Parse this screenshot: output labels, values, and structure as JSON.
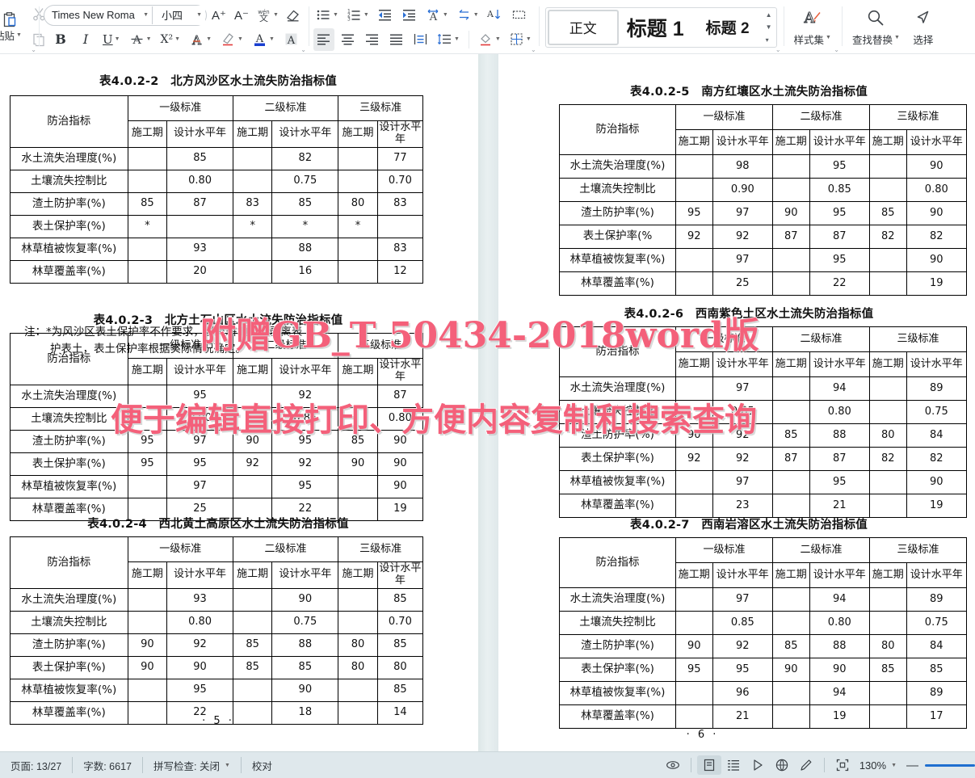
{
  "ribbon": {
    "paste": {
      "label": "粘贴",
      "icon": "paste-icon"
    },
    "cut": {
      "icon": "scissors-icon"
    },
    "copy": {
      "icon": "copy-icon"
    },
    "font_name": "Times New Roma",
    "font_size": "小四",
    "grow_font": "A⁺",
    "shrink_font": "A⁻",
    "phonetic": "文",
    "clear_format": "clear-formatting-icon",
    "bold": "B",
    "italic": "I",
    "underline": "U",
    "strikethrough": "A",
    "superscript": "X²",
    "text_effects": "A",
    "highlight": "A",
    "font_color": "A",
    "char_shading": "A",
    "styles": {
      "items": [
        {
          "label": "正文",
          "current": true
        },
        {
          "label": "标题 1",
          "current": false
        },
        {
          "label": "标题 2",
          "current": false
        }
      ],
      "gallery_label": "样式集"
    },
    "find_replace": "查找替换",
    "select": "选择"
  },
  "watermarks": {
    "line1": "附赠GB_T 50434-2018word版",
    "line2": "便于编辑直接打印、方便内容复制和搜索查询"
  },
  "document": {
    "common": {
      "row_header_label": "防治指标",
      "levels": [
        "一级标准",
        "二级标准",
        "三级标准"
      ],
      "subcols": [
        "施工期",
        "设计水平年"
      ],
      "indicators": [
        "水土流失治理度(%)",
        "土壤流失控制比",
        "渣土防护率(%)",
        "表土保护率(%)",
        "林草植被恢复率(%)",
        "林草覆盖率(%)"
      ]
    },
    "left_page": {
      "page_number": "· 5 ·",
      "tables": [
        {
          "title": "表4.0.2-2　北方风沙区水土流失防治指标值",
          "rows": [
            {
              "name": "水土流失治理度(%)",
              "cells": [
                "",
                "85",
                "",
                "82",
                "",
                "77"
              ]
            },
            {
              "name": "土壤流失控制比",
              "cells": [
                "",
                "0.80",
                "",
                "0.75",
                "",
                "0.70"
              ]
            },
            {
              "name": "渣土防护率(%)",
              "cells": [
                "85",
                "87",
                "83",
                "85",
                "80",
                "83"
              ]
            },
            {
              "name": "表土保护率(%)",
              "cells": [
                "*",
                "",
                "*",
                "*",
                "*",
                ""
              ]
            },
            {
              "name": "林草植被恢复率(%)",
              "cells": [
                "",
                "93",
                "",
                "88",
                "",
                "83"
              ]
            },
            {
              "name": "林草覆盖率(%)",
              "cells": [
                "",
                "20",
                "",
                "16",
                "",
                "12"
              ]
            }
          ],
          "note_line1": "注：*为风沙区表土保护率不作要求，当有耕地时，剥离表",
          "note_line2": "护表土，表土保护率根据实际情况确定。"
        },
        {
          "title": "表4.0.2-3　北方土石山区水土流失防治指标值",
          "rows": [
            {
              "name": "水土流失治理度(%)",
              "cells": [
                "",
                "95",
                "",
                "92",
                "",
                "87"
              ]
            },
            {
              "name": "土壤流失控制比",
              "cells": [
                "",
                "0.90",
                "",
                "0.85",
                "",
                "0.80"
              ]
            },
            {
              "name": "渣土防护率(%)",
              "cells": [
                "95",
                "97",
                "90",
                "95",
                "85",
                "90"
              ]
            },
            {
              "name": "表土保护率(%)",
              "cells": [
                "95",
                "95",
                "92",
                "92",
                "90",
                "90"
              ]
            },
            {
              "name": "林草植被恢复率(%)",
              "cells": [
                "",
                "97",
                "",
                "95",
                "",
                "90"
              ]
            },
            {
              "name": "林草覆盖率(%)",
              "cells": [
                "",
                "25",
                "",
                "22",
                "",
                "19"
              ]
            }
          ]
        },
        {
          "title": "表4.0.2-4　西北黄土高原区水土流失防治指标值",
          "rows": [
            {
              "name": "水土流失治理度(%)",
              "cells": [
                "",
                "93",
                "",
                "90",
                "",
                "85"
              ]
            },
            {
              "name": "土壤流失控制比",
              "cells": [
                "",
                "0.80",
                "",
                "0.75",
                "",
                "0.70"
              ]
            },
            {
              "name": "渣土防护率(%)",
              "cells": [
                "90",
                "92",
                "85",
                "88",
                "80",
                "85"
              ]
            },
            {
              "name": "表土保护率(%)",
              "cells": [
                "90",
                "90",
                "85",
                "85",
                "80",
                "80"
              ]
            },
            {
              "name": "林草植被恢复率(%)",
              "cells": [
                "",
                "95",
                "",
                "90",
                "",
                "85"
              ]
            },
            {
              "name": "林草覆盖率(%)",
              "cells": [
                "",
                "22",
                "",
                "18",
                "",
                "14"
              ]
            }
          ]
        }
      ]
    },
    "right_page": {
      "page_number": "· 6 ·",
      "tables": [
        {
          "title": "表4.0.2-5　南方红壤区水土流失防治指标值",
          "rows": [
            {
              "name": "水土流失治理度(%)",
              "cells": [
                "",
                "98",
                "",
                "95",
                "",
                "90"
              ]
            },
            {
              "name": "土壤流失控制比",
              "cells": [
                "",
                "0.90",
                "",
                "0.85",
                "",
                "0.80"
              ]
            },
            {
              "name": "渣土防护率(%)",
              "cells": [
                "95",
                "97",
                "90",
                "95",
                "85",
                "90"
              ]
            },
            {
              "name": "表土保护率(%",
              "cells": [
                "92",
                "92",
                "87",
                "87",
                "82",
                "82"
              ]
            },
            {
              "name": "林草植被恢复率(%)",
              "cells": [
                "",
                "97",
                "",
                "95",
                "",
                "90"
              ]
            },
            {
              "name": "林草覆盖率(%)",
              "cells": [
                "",
                "25",
                "",
                "22",
                "",
                "19"
              ]
            }
          ]
        },
        {
          "title": "表4.0.2-6　西南紫色土区水土流失防治指标值",
          "rows": [
            {
              "name": "水土流失治理度(%)",
              "cells": [
                "",
                "97",
                "",
                "94",
                "",
                "89"
              ]
            },
            {
              "name": "土壤流失控制比",
              "cells": [
                "",
                "0.85",
                "",
                "0.80",
                "",
                "0.75"
              ]
            },
            {
              "name": "渣土防护率(%)",
              "cells": [
                "90",
                "92",
                "85",
                "88",
                "80",
                "84"
              ]
            },
            {
              "name": "表土保护率(%)",
              "cells": [
                "92",
                "92",
                "87",
                "87",
                "82",
                "82"
              ]
            },
            {
              "name": "林草植被恢复率(%)",
              "cells": [
                "",
                "97",
                "",
                "95",
                "",
                "90"
              ]
            },
            {
              "name": "林草覆盖率(%)",
              "cells": [
                "",
                "23",
                "",
                "21",
                "",
                "19"
              ]
            }
          ]
        },
        {
          "title": "表4.0.2-7　西南岩溶区水土流失防治指标值",
          "rows": [
            {
              "name": "水土流失治理度(%)",
              "cells": [
                "",
                "97",
                "",
                "94",
                "",
                "89"
              ]
            },
            {
              "name": "土壤流失控制比",
              "cells": [
                "",
                "0.85",
                "",
                "0.80",
                "",
                "0.75"
              ]
            },
            {
              "name": "渣土防护率(%)",
              "cells": [
                "90",
                "92",
                "85",
                "88",
                "80",
                "84"
              ]
            },
            {
              "name": "表土保护率(%)",
              "cells": [
                "95",
                "95",
                "90",
                "90",
                "85",
                "85"
              ]
            },
            {
              "name": "林草植被恢复率(%)",
              "cells": [
                "",
                "96",
                "",
                "94",
                "",
                "89"
              ]
            },
            {
              "name": "林草覆盖率(%)",
              "cells": [
                "",
                "21",
                "",
                "19",
                "",
                "17"
              ]
            }
          ]
        }
      ]
    }
  },
  "status_bar": {
    "page": "页面: 13/27",
    "words": "字数: 6617",
    "spellcheck": "拼写检查: 关闭",
    "proofread": "校对",
    "zoom": "130%",
    "icons": [
      "eye-icon",
      "page-layout-icon",
      "outline-icon",
      "web-layout-icon",
      "globe-icon",
      "pen-icon",
      "fullscreen-icon"
    ]
  }
}
